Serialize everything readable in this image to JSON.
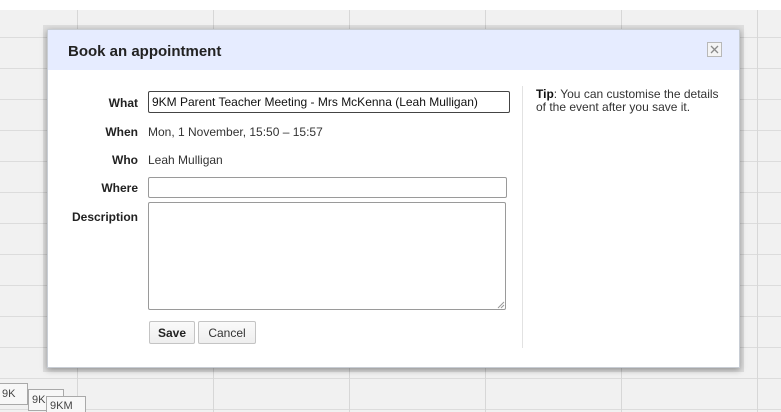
{
  "background": {
    "event_chips": [
      "9K",
      "9K",
      "9KM"
    ]
  },
  "dialog": {
    "title": "Book an appointment",
    "close_icon": "close-icon",
    "form": {
      "what_label": "What",
      "what_value": "9KM Parent Teacher Meeting - Mrs McKenna (Leah Mulligan)",
      "when_label": "When",
      "when_value": "Mon, 1 November, 15:50 – 15:57",
      "who_label": "Who",
      "who_value": "Leah Mulligan",
      "where_label": "Where",
      "where_value": "",
      "description_label": "Description",
      "description_value": ""
    },
    "buttons": {
      "save_label": "Save",
      "cancel_label": "Cancel"
    },
    "tip": {
      "label": "Tip",
      "text": ": You can customise the details of the event after you save it."
    }
  },
  "colors": {
    "header_bg": "#e6ecff",
    "grid_bg": "#f1f1f1"
  }
}
